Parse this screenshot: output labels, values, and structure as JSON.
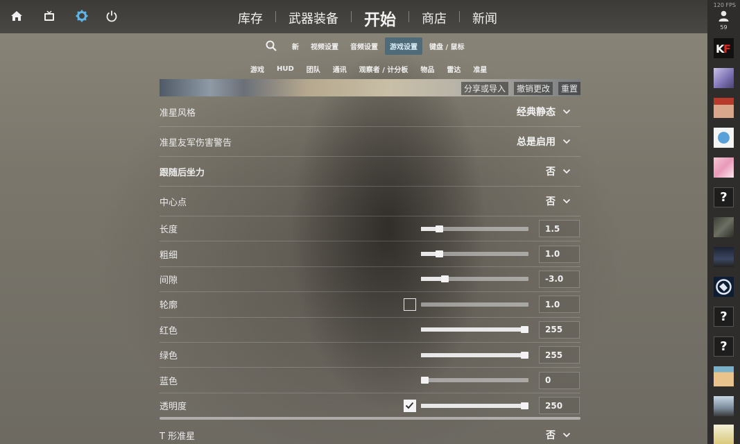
{
  "topbar": {
    "nav": [
      "库存",
      "武器装备",
      "开始",
      "商店",
      "新闻"
    ],
    "fps": "120 FPS",
    "user_count": "59"
  },
  "subnav": {
    "items": [
      "新",
      "视频设置",
      "音频设置",
      "游戏设置",
      "键盘 / 鼠标"
    ],
    "active": "游戏设置"
  },
  "categories": [
    "游戏",
    "HUD",
    "团队",
    "通讯",
    "观察者 / 计分板",
    "物品",
    "雷达",
    "准星"
  ],
  "preview": {
    "share_label": "分享或导入",
    "revert_label": "撤销更改",
    "reset_label": "重置"
  },
  "settings": {
    "crosshair_style": {
      "label": "准星风格",
      "value": "经典静态"
    },
    "friendly_warning": {
      "label": "准星友军伤害警告",
      "value": "总是启用"
    },
    "follow_recoil": {
      "label": "跟随后坐力",
      "value": "否"
    },
    "center_dot": {
      "label": "中心点",
      "value": "否"
    },
    "length": {
      "label": "长度",
      "value": "1.5",
      "fill": 0.17
    },
    "thickness": {
      "label": "粗细",
      "value": "1.0",
      "fill": 0.17
    },
    "gap": {
      "label": "间隙",
      "value": "-3.0",
      "fill": 0.22
    },
    "outline": {
      "label": "轮廓",
      "value": "1.0",
      "fill": 0.0,
      "checked": false
    },
    "red": {
      "label": "红色",
      "value": "255",
      "fill": 1.0
    },
    "green": {
      "label": "绿色",
      "value": "255",
      "fill": 1.0
    },
    "blue": {
      "label": "蓝色",
      "value": "0",
      "fill": 0.0
    },
    "alpha": {
      "label": "透明度",
      "value": "250",
      "fill": 0.98,
      "checked": true
    },
    "t_style": {
      "label": "T 形准星",
      "value": "否"
    }
  },
  "friends": [
    "kf-logo-avatar",
    "anime-avatar",
    "red-cap-avatar",
    "blue-creature-avatar",
    "pink-anime-avatar",
    "unknown-avatar",
    "dark-avatar",
    "dark-scene-avatar",
    "team-liquid-avatar",
    "unknown-avatar",
    "unknown-avatar",
    "cartoon-avatar",
    "girl-avatar",
    "creature-avatar"
  ]
}
